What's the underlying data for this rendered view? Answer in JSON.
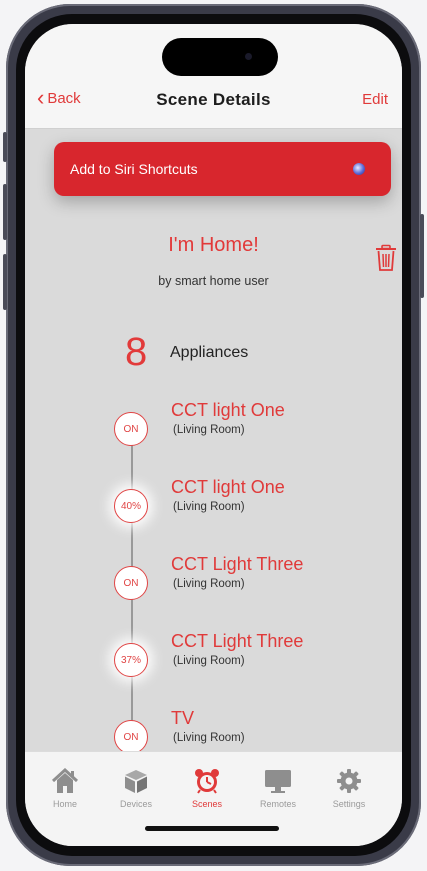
{
  "nav": {
    "back_label": "Back",
    "title": "Scene Details",
    "edit_label": "Edit"
  },
  "siri": {
    "label": "Add to Siri Shortcuts"
  },
  "scene": {
    "name": "I'm Home!",
    "author": "by smart home user"
  },
  "appliances": {
    "count": "8",
    "label": "Appliances",
    "items": [
      {
        "state": "ON",
        "name": "CCT light One",
        "room": "(Living Room)"
      },
      {
        "state": "40%",
        "name": "CCT light One",
        "room": "(Living Room)"
      },
      {
        "state": "ON",
        "name": "CCT Light Three",
        "room": "(Living Room)"
      },
      {
        "state": "37%",
        "name": "CCT Light Three",
        "room": "(Living Room)"
      },
      {
        "state": "ON",
        "name": "TV",
        "room": "(Living Room)"
      }
    ]
  },
  "tabs": [
    {
      "label": "Home",
      "icon": "house-icon"
    },
    {
      "label": "Devices",
      "icon": "cube-icon"
    },
    {
      "label": "Scenes",
      "icon": "alarm-clock-icon",
      "active": true
    },
    {
      "label": "Remotes",
      "icon": "monitor-icon"
    },
    {
      "label": "Settings",
      "icon": "gear-icon"
    }
  ],
  "colors": {
    "accent": "#e03a3a",
    "siri_button": "#d8262d",
    "background": "#dadada"
  }
}
